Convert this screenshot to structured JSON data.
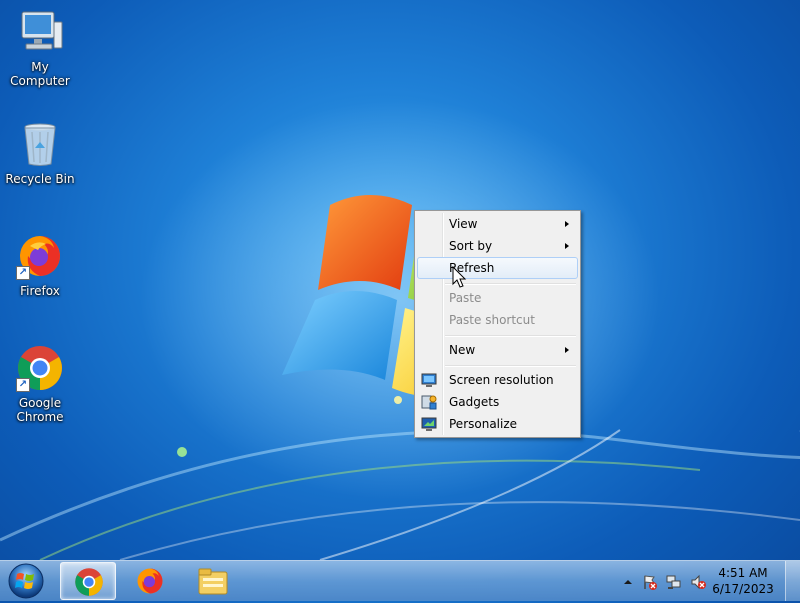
{
  "desktop": {
    "icons": [
      {
        "label": "My Computer"
      },
      {
        "label": "Recycle Bin"
      },
      {
        "label": "Firefox"
      },
      {
        "label": "Google\nChrome"
      }
    ]
  },
  "context_menu": {
    "items": [
      {
        "label": "View",
        "submenu": true
      },
      {
        "label": "Sort by",
        "submenu": true
      },
      {
        "label": "Refresh",
        "state": "hover"
      },
      {
        "label": "Paste",
        "state": "disabled"
      },
      {
        "label": "Paste shortcut",
        "state": "disabled"
      },
      {
        "label": "New",
        "submenu": true
      },
      {
        "label": "Screen resolution",
        "icon": "screen-resolution-icon"
      },
      {
        "label": "Gadgets",
        "icon": "gadgets-icon"
      },
      {
        "label": "Personalize",
        "icon": "personalize-icon"
      }
    ]
  },
  "taskbar": {
    "pinned": [
      "chrome-icon",
      "firefox-icon",
      "file-explorer-icon"
    ],
    "tray_icons": [
      "show-hidden-icons-arrow",
      "action-center-flag-icon",
      "network-icon",
      "volume-muted-icon"
    ],
    "clock": {
      "time": "4:51 AM",
      "date": "6/17/2023"
    }
  },
  "colors": {
    "desktop_blue": "#1e7fd6",
    "menu_bg": "#f0f0f0",
    "menu_hover_border": "#aecff7",
    "disabled_text": "#8c8c8c"
  }
}
